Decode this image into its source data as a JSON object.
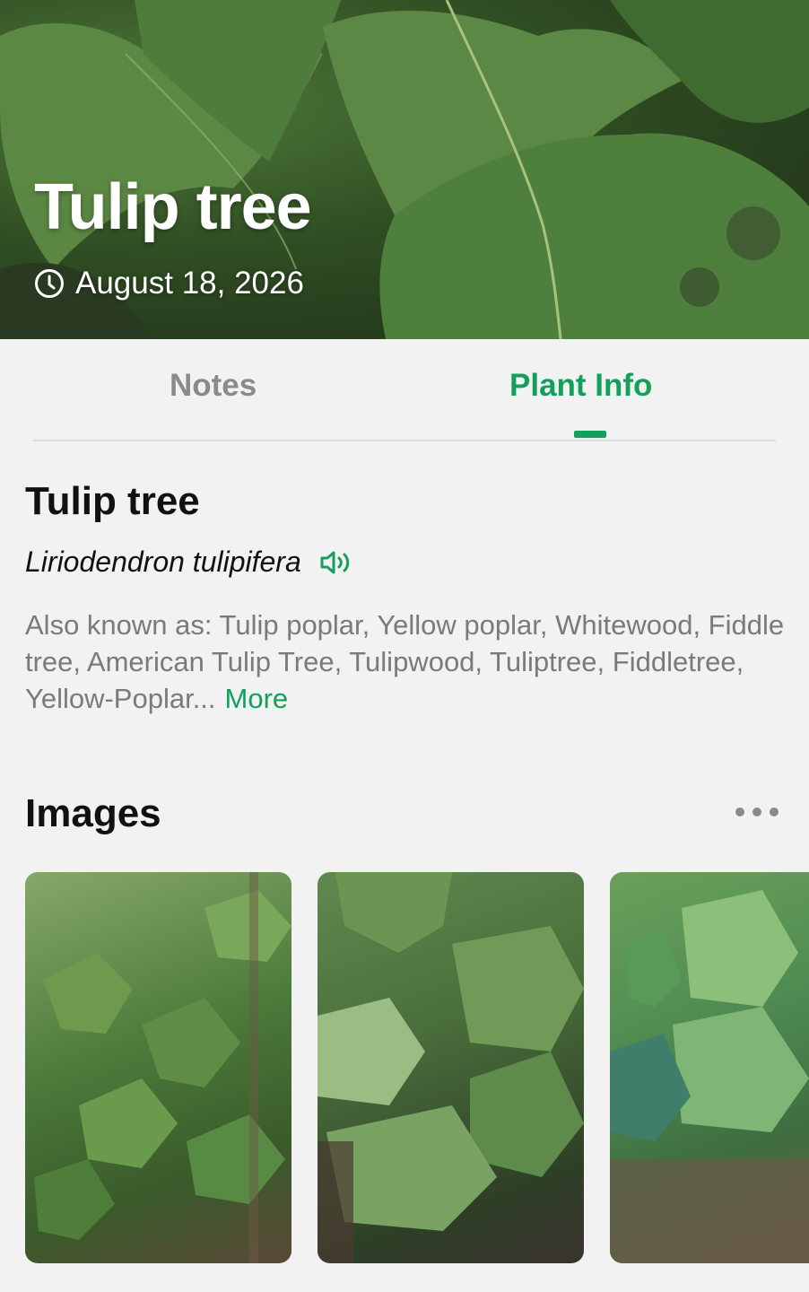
{
  "hero": {
    "title": "Tulip tree",
    "date": "August 18, 2026",
    "date_icon": "clock-icon"
  },
  "tabs": [
    {
      "label": "Notes",
      "active": false
    },
    {
      "label": "Plant Info",
      "active": true
    }
  ],
  "plant": {
    "common_name": "Tulip tree",
    "scientific_name": "Liriodendron tulipifera",
    "pronounce_icon": "speaker-icon",
    "also_known_as": "Also known as: Tulip poplar, Yellow poplar, Whitewood, Fiddle tree, American Tulip Tree, Tulipwood, Tuliptree, Fiddletree, Yellow-Poplar...",
    "more_label": "More"
  },
  "images_section": {
    "title": "Images",
    "menu_icon": "more-dots-icon",
    "count_visible": 3
  },
  "colors": {
    "accent": "#12a05c",
    "muted_text": "#7a7a7a",
    "background": "#f2f2f2"
  }
}
